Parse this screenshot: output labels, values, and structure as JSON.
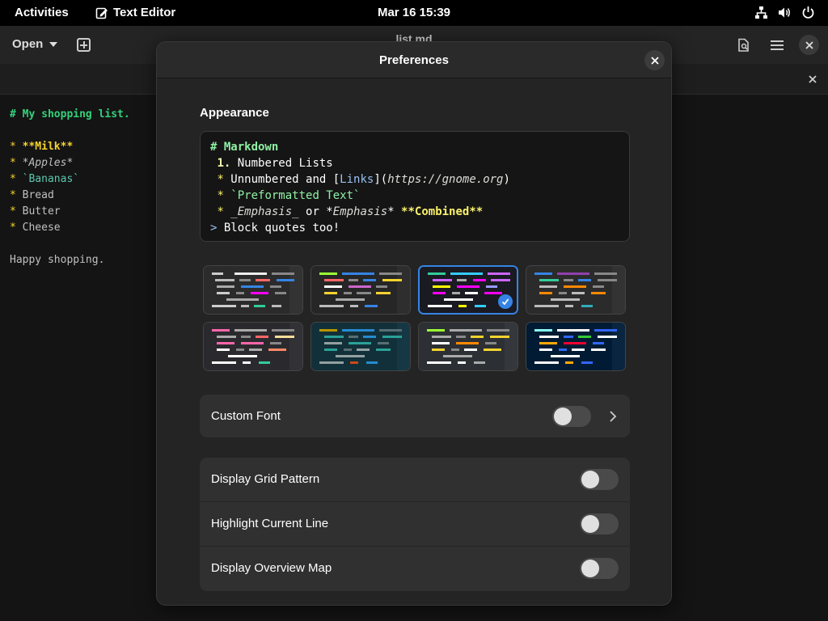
{
  "topbar": {
    "activities": "Activities",
    "app_name": "Text Editor",
    "clock": "Mar 16  15:39",
    "tray": [
      "network-icon",
      "volume-icon",
      "power-icon"
    ]
  },
  "editor": {
    "open_label": "Open",
    "file_title": "list.md",
    "text": {
      "heading": "# My shopping list.",
      "items": [
        {
          "prefix": "* ",
          "text": "**Milk**",
          "style": "bold"
        },
        {
          "prefix": "* ",
          "text": "*Apples*",
          "style": "italic"
        },
        {
          "prefix": "* ",
          "text": "`Bananas`",
          "style": "code"
        },
        {
          "prefix": "* ",
          "text": "Bread",
          "style": "plain"
        },
        {
          "prefix": "* ",
          "text": "Butter",
          "style": "plain"
        },
        {
          "prefix": "* ",
          "text": "Cheese",
          "style": "plain"
        }
      ],
      "footer": "Happy shopping."
    }
  },
  "dialog": {
    "title": "Preferences",
    "appearance_title": "Appearance",
    "preview": {
      "l1": "# Markdown",
      "l2_num": "1.",
      "l2_text": " Numbered Lists",
      "l3_bullet": "*",
      "l3_a": " Unnumbered and [",
      "l3_link": "Links",
      "l3_b": "](",
      "l3_url": "https://gnome.org",
      "l3_c": ")",
      "l4_bullet": "*",
      "l4_code": " `Preformatted Text`",
      "l5_bullet": "*",
      "l5_a": " _Emphasis_",
      "l5_b": " or *",
      "l5_emph": "Emphasis",
      "l5_c": "* ",
      "l5_comb": "**Combined**",
      "l6_gt": ">",
      "l6_text": " Block quotes too!"
    },
    "schemes": [
      {
        "name": "scheme-1",
        "bg": "#2b2b2b",
        "side": "#333333",
        "selected": false
      },
      {
        "name": "scheme-2",
        "bg": "#262626",
        "side": "#2e2e2e",
        "selected": false
      },
      {
        "name": "scheme-3",
        "bg": "#1a1a22",
        "side": "#1a1a22",
        "selected": true
      },
      {
        "name": "scheme-4",
        "bg": "#2b2b2b",
        "side": "#333333",
        "selected": false
      },
      {
        "name": "scheme-5",
        "bg": "#2a2a2e",
        "side": "#323236",
        "selected": false
      },
      {
        "name": "scheme-6",
        "bg": "#123039",
        "side": "#163844",
        "selected": false
      },
      {
        "name": "scheme-7",
        "bg": "#2c2f33",
        "side": "#34383c",
        "selected": false
      },
      {
        "name": "scheme-8",
        "bg": "#001b33",
        "side": "#0a2540",
        "selected": false
      }
    ],
    "custom_font_label": "Custom Font",
    "rows": [
      {
        "label": "Display Grid Pattern",
        "on": false
      },
      {
        "label": "Highlight Current Line",
        "on": false
      },
      {
        "label": "Display Overview Map",
        "on": false
      }
    ],
    "accent_color": "#3584e4"
  }
}
